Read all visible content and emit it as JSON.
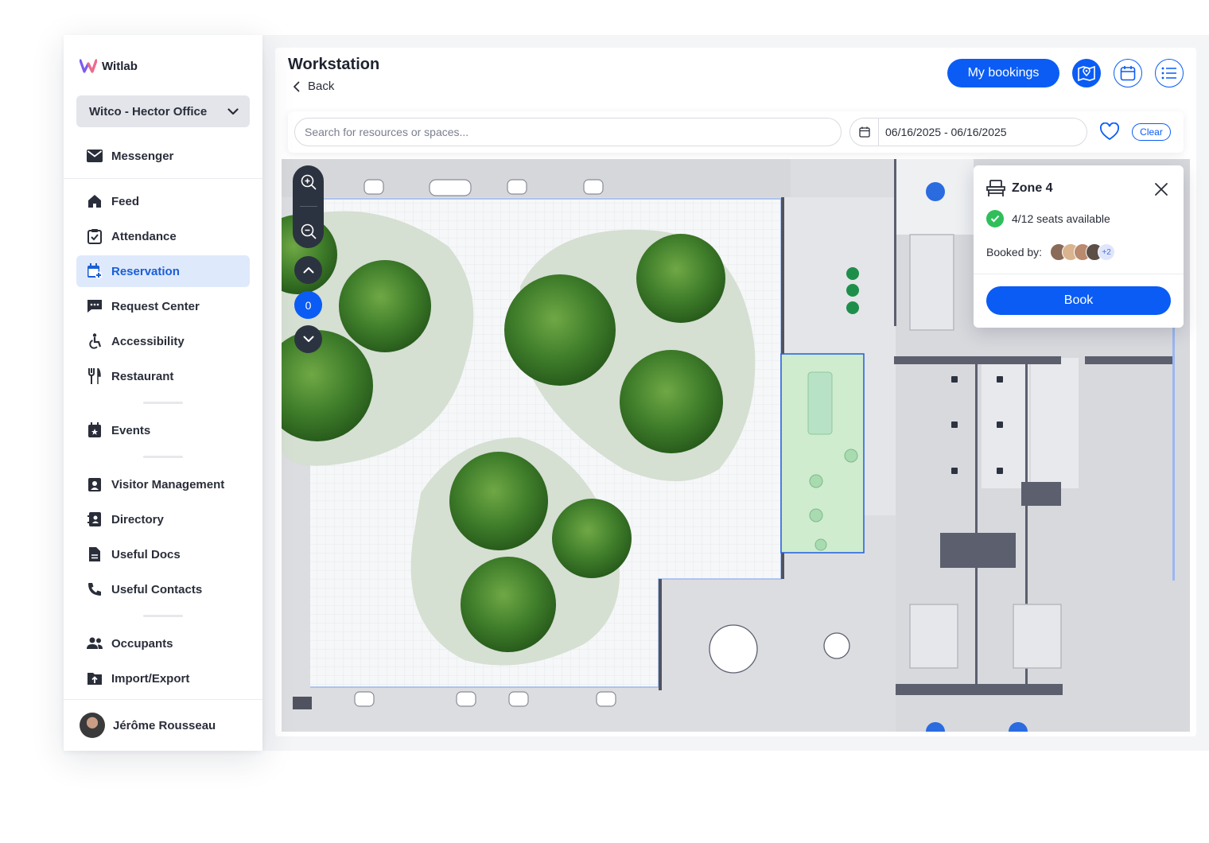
{
  "app": {
    "name": "Witlab"
  },
  "sidebar": {
    "organization": "Witco - Hector Office",
    "items": [
      {
        "label": "Messenger",
        "icon": "mail-icon"
      },
      {
        "label": "Feed",
        "icon": "home-icon"
      },
      {
        "label": "Attendance",
        "icon": "clipboard-check-icon"
      },
      {
        "label": "Reservation",
        "icon": "calendar-plus-icon",
        "active": true
      },
      {
        "label": "Request Center",
        "icon": "chat-bubble-icon"
      },
      {
        "label": "Accessibility",
        "icon": "accessibility-icon"
      },
      {
        "label": "Restaurant",
        "icon": "fork-knife-icon"
      },
      {
        "label": "Events",
        "icon": "calendar-star-icon"
      },
      {
        "label": "Visitor Management",
        "icon": "visitor-badge-icon"
      },
      {
        "label": "Directory",
        "icon": "contact-book-icon"
      },
      {
        "label": "Useful Docs",
        "icon": "document-icon"
      },
      {
        "label": "Useful Contacts",
        "icon": "phone-icon"
      },
      {
        "label": "Occupants",
        "icon": "people-icon"
      },
      {
        "label": "Import/Export",
        "icon": "folder-upload-icon"
      }
    ],
    "user": {
      "name": "Jérôme Rousseau"
    }
  },
  "header": {
    "title": "Workstation",
    "back_label": "Back",
    "my_bookings_label": "My bookings"
  },
  "filters": {
    "search_placeholder": "Search for resources or spaces...",
    "date_range": "06/16/2025 - 06/16/2025",
    "clear_label": "Clear"
  },
  "map": {
    "current_floor": "0"
  },
  "zone_popup": {
    "title": "Zone 4",
    "availability": "4/12 seats available",
    "booked_by_label": "Booked by:",
    "extra_count": "+2",
    "book_label": "Book"
  },
  "colors": {
    "accent": "#0a5cf5",
    "active_bg": "#dfe9fc",
    "available_green": "#2fbf5a",
    "zone_fill": "#cfeccf"
  }
}
